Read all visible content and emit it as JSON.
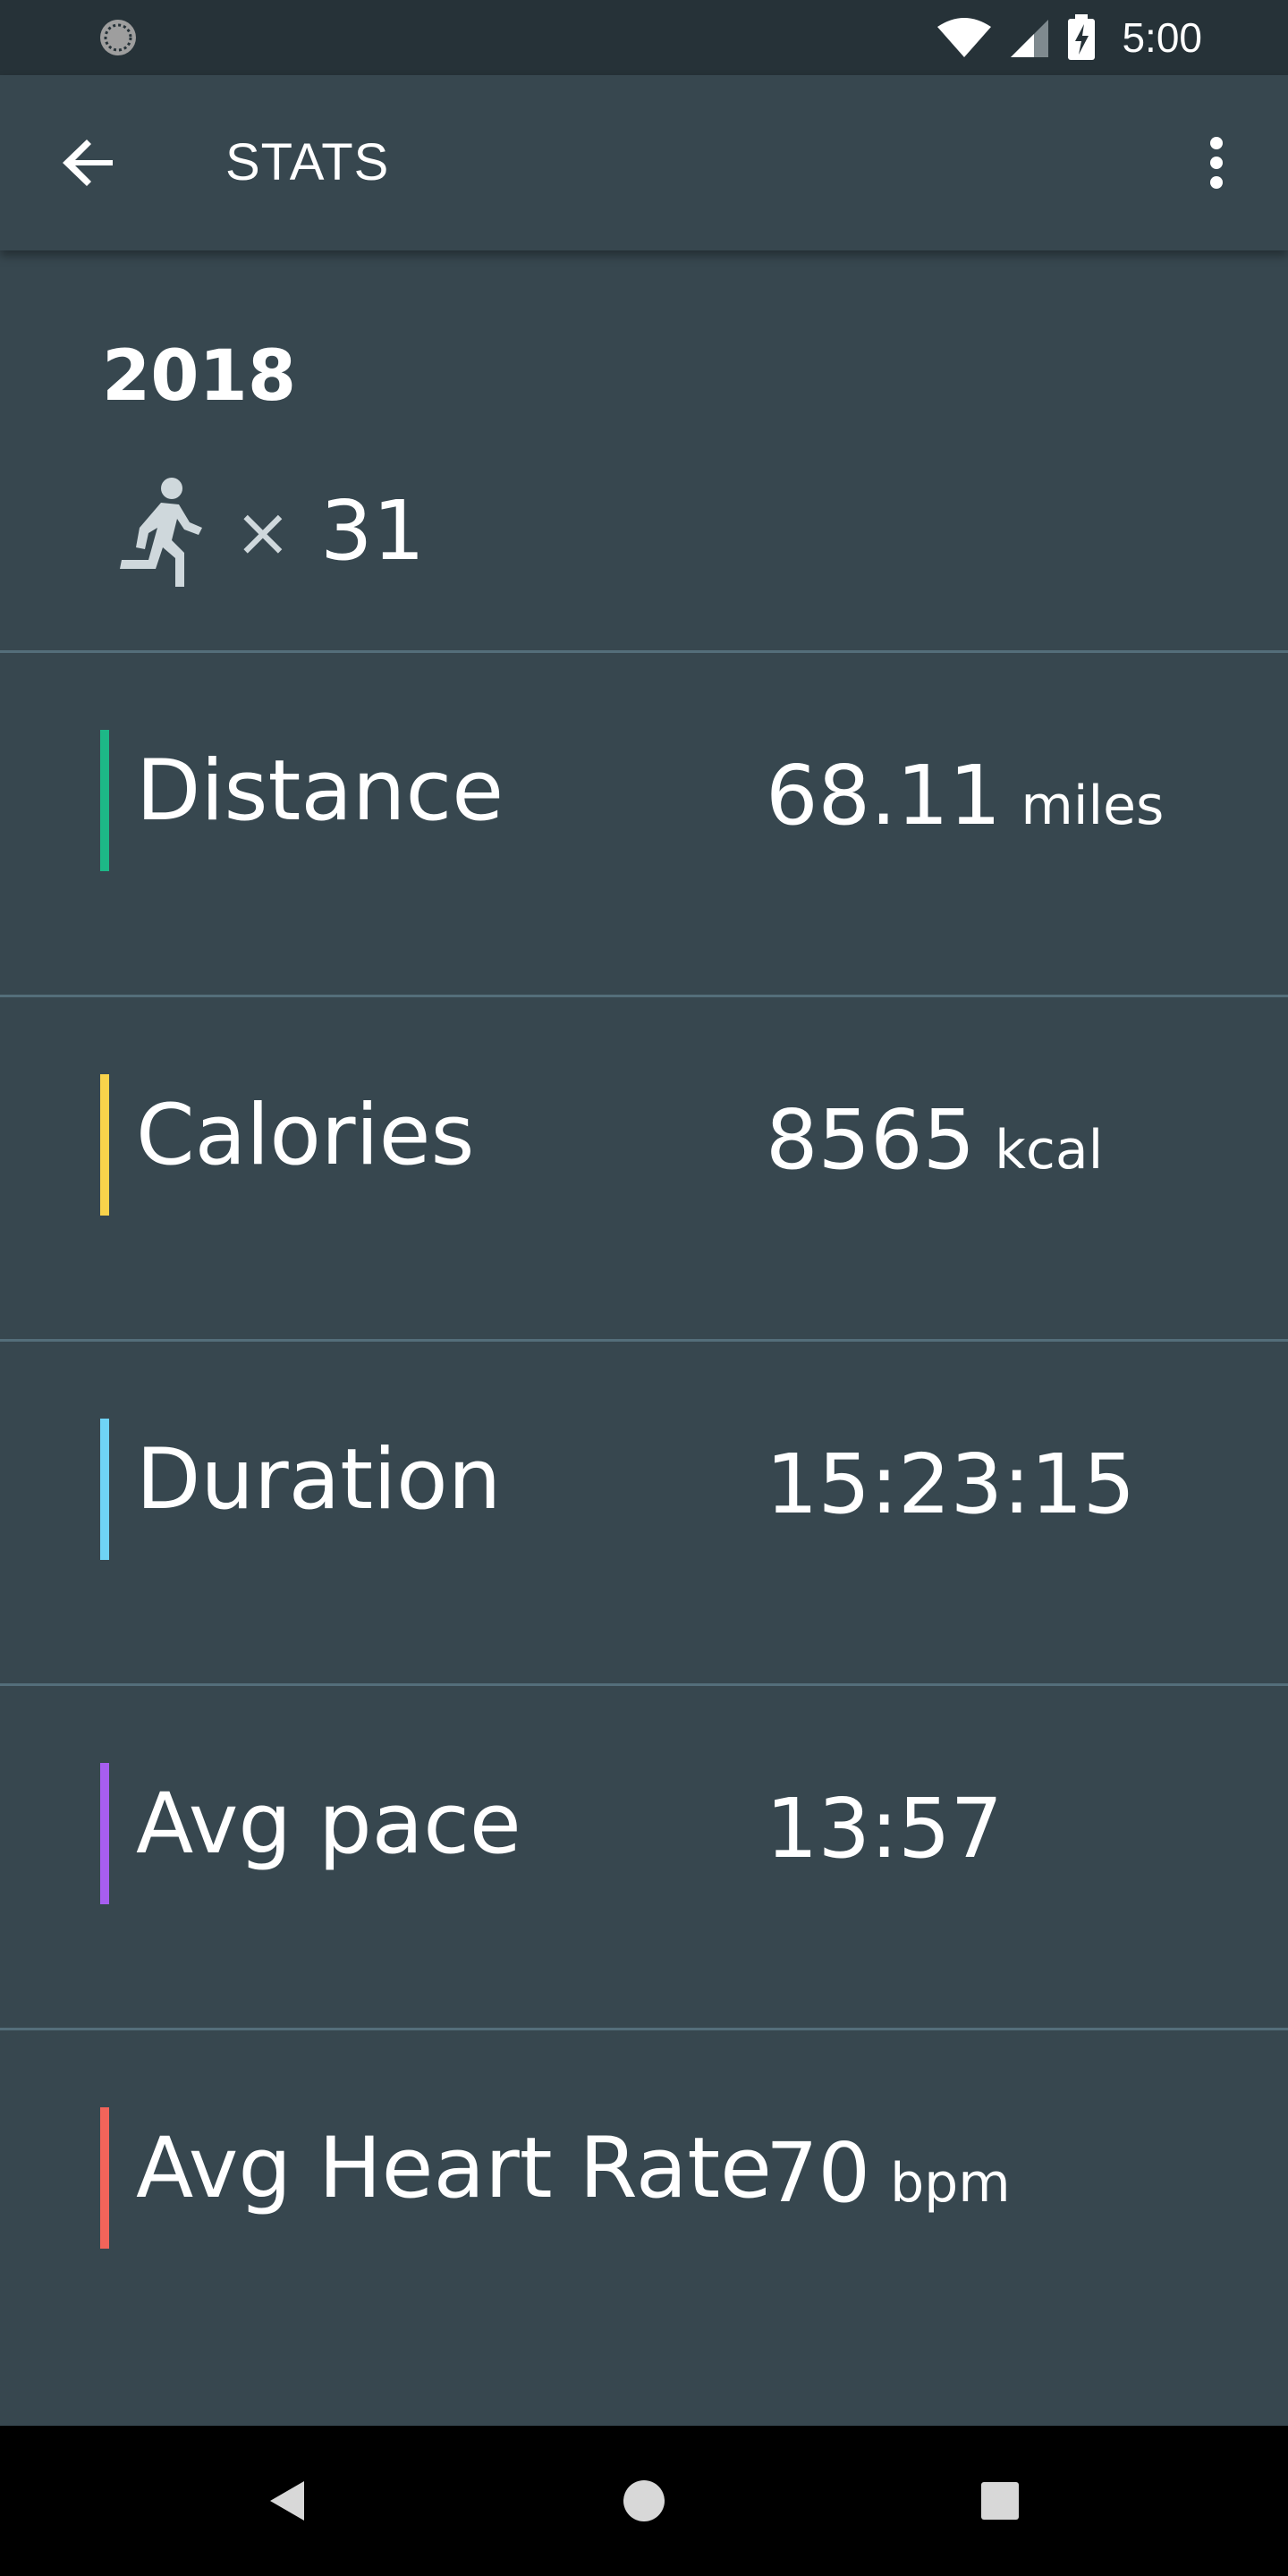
{
  "status_bar": {
    "time": "5:00",
    "icons": [
      "notification-icon",
      "wifi-icon",
      "cell-signal-icon",
      "battery-charging-icon"
    ]
  },
  "app_bar": {
    "title": "STATS",
    "back_icon": "arrow-back-icon",
    "menu_icon": "more-vert-icon"
  },
  "summary": {
    "year": "2018",
    "activity_icon": "running-icon",
    "times_sign": "×",
    "count": "31"
  },
  "stats": [
    {
      "label": "Distance",
      "value": "68.11",
      "unit": "miles",
      "color": "#1db887"
    },
    {
      "label": "Calories",
      "value": "8565",
      "unit": "kcal",
      "color": "#f9d34b"
    },
    {
      "label": "Duration",
      "value": "15:23:15",
      "unit": "",
      "color": "#6fd3f5"
    },
    {
      "label": "Avg pace",
      "value": "13:57",
      "unit": "",
      "color": "#a75ef1"
    },
    {
      "label": "Avg Heart Rate",
      "value": "70",
      "unit": "bpm",
      "color": "#f2645a"
    }
  ],
  "nav_bar": {
    "icons": [
      "back-triangle-icon",
      "home-circle-icon",
      "recents-square-icon"
    ]
  }
}
